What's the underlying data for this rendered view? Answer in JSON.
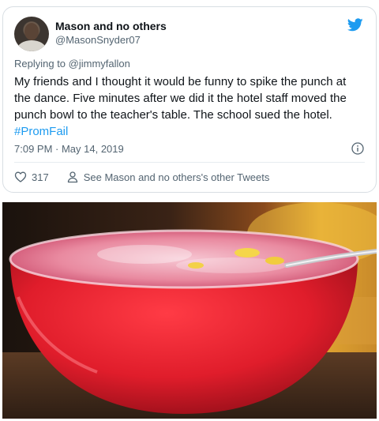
{
  "tweet": {
    "display_name": "Mason and no others",
    "handle": "@MasonSnyder07",
    "replying_to_prefix": "Replying to ",
    "replying_to_user": "@jimmyfallon",
    "text": "My friends and I thought it would be funny to spike the punch at the dance. Five minutes after we did it the hotel staff moved the punch bowl to the teacher's table. The school sued the hotel. ",
    "hashtag": "#PromFail",
    "timestamp": "7:09 PM · May 14, 2019",
    "like_count": "317",
    "other_tweets_link": "See Mason and no others's other Tweets"
  },
  "icons": {
    "brand": "twitter-bird-icon",
    "info": "info-icon",
    "like": "heart-icon",
    "profile": "person-icon"
  },
  "colors": {
    "link": "#1d9bf0",
    "secondary_text": "#536471",
    "punch": "#d9202c"
  }
}
